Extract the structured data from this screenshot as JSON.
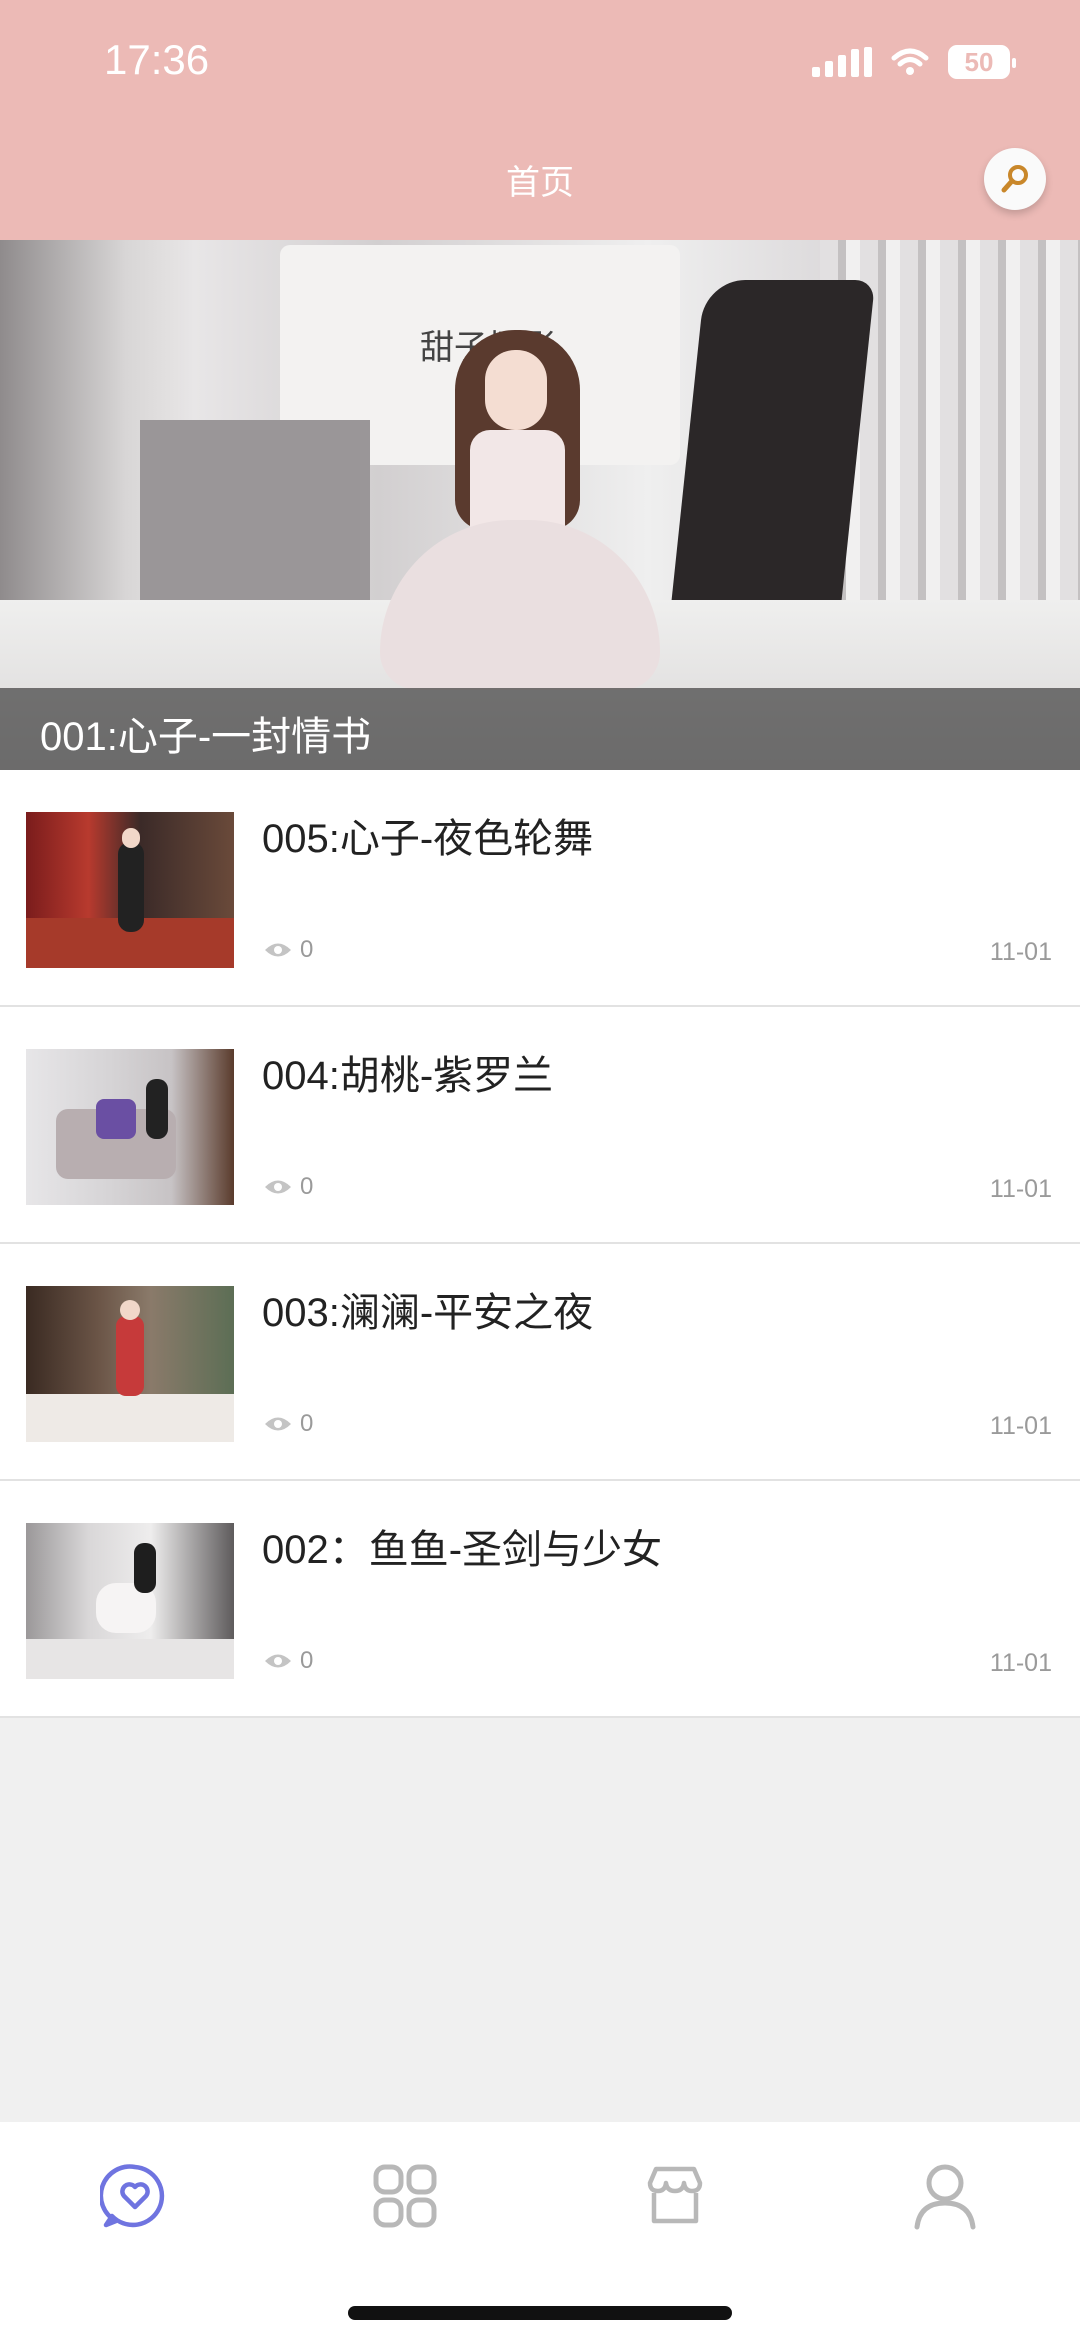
{
  "status_bar": {
    "time": "17:36",
    "battery": "50"
  },
  "header": {
    "title": "首页"
  },
  "hero": {
    "caption": "001:心子-一封情书",
    "banner_text": "甜子摄影"
  },
  "articles": [
    {
      "title": "005:心子-夜色轮舞",
      "views": "0",
      "date": "11-01",
      "thumb_tone": "red-room"
    },
    {
      "title": "004:胡桃-紫罗兰",
      "views": "0",
      "date": "11-01",
      "thumb_tone": "white-sofa"
    },
    {
      "title": "003:澜澜-平安之夜",
      "views": "0",
      "date": "11-01",
      "thumb_tone": "christmas-piano"
    },
    {
      "title": "002：鱼鱼-圣剑与少女",
      "views": "0",
      "date": "11-01",
      "thumb_tone": "gray-room"
    }
  ],
  "tabbar": {
    "tabs": [
      {
        "icon": "chat-heart-icon",
        "active": true,
        "color": "#6f74e0"
      },
      {
        "icon": "grid-icon",
        "active": false,
        "color": "#b8b8b8"
      },
      {
        "icon": "shop-icon",
        "active": false,
        "color": "#b8b8b8"
      },
      {
        "icon": "person-icon",
        "active": false,
        "color": "#b8b8b8"
      }
    ]
  },
  "colors": {
    "header_bg": "#ecbab6",
    "accent": "#6f74e0",
    "meta_text": "#9a9a9a"
  }
}
